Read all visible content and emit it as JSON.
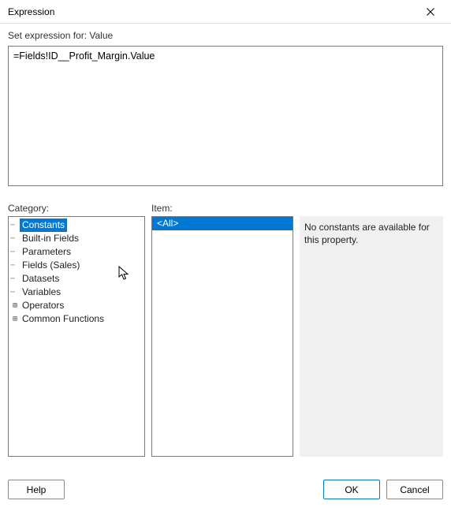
{
  "window": {
    "title": "Expression",
    "close_aria": "Close"
  },
  "header": {
    "set_label_prefix": "Set expression for: ",
    "set_label_target": "Value"
  },
  "expression": {
    "value": "=Fields!ID__Profit_Margin.Value"
  },
  "labels": {
    "category": "Category:",
    "item": "Item:"
  },
  "category_tree": [
    {
      "label": "Constants",
      "expandable": false,
      "selected": true
    },
    {
      "label": "Built-in Fields",
      "expandable": false,
      "selected": false
    },
    {
      "label": "Parameters",
      "expandable": false,
      "selected": false
    },
    {
      "label": "Fields (Sales)",
      "expandable": false,
      "selected": false
    },
    {
      "label": "Datasets",
      "expandable": false,
      "selected": false
    },
    {
      "label": "Variables",
      "expandable": false,
      "selected": false
    },
    {
      "label": "Operators",
      "expandable": true,
      "selected": false
    },
    {
      "label": "Common Functions",
      "expandable": true,
      "selected": false
    }
  ],
  "items": [
    {
      "label": "<All>",
      "selected": true
    }
  ],
  "description": {
    "text": "No constants are available for this property."
  },
  "buttons": {
    "help": "Help",
    "ok": "OK",
    "cancel": "Cancel"
  }
}
